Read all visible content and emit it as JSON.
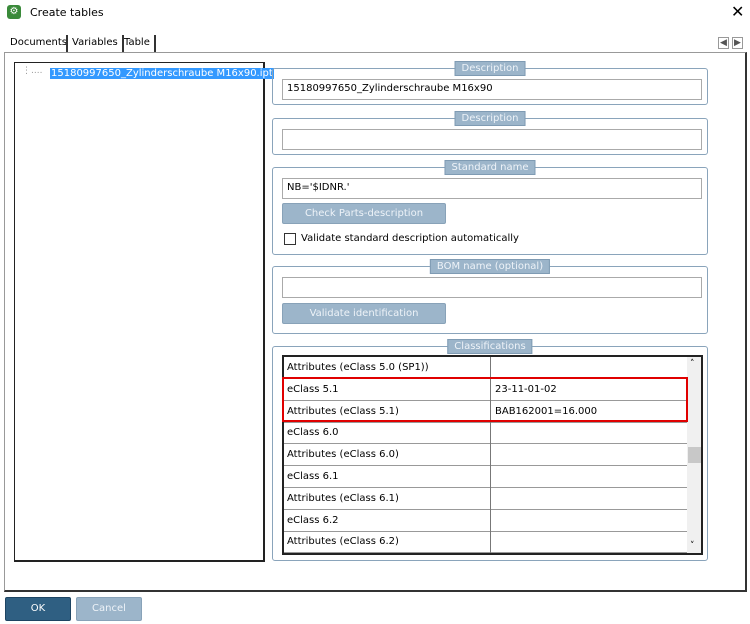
{
  "window": {
    "title": "Create tables",
    "icon": "app-gear-icon",
    "close": "✕"
  },
  "tabs": [
    {
      "label": "Documents"
    },
    {
      "label": "Variables"
    },
    {
      "label": "Table"
    }
  ],
  "nav": {
    "prev": "◀",
    "next": "▶"
  },
  "tree": {
    "item": "15180997650_Zylinderschraube M16x90.ipt",
    "connector": "⋮...."
  },
  "groups": {
    "desc1": {
      "legend": "Description",
      "value": "15180997650_Zylinderschraube M16x90"
    },
    "desc2": {
      "legend": "Description",
      "value": ""
    },
    "standard": {
      "legend": "Standard name",
      "value": "NB='$IDNR.'",
      "button": "Check Parts-description",
      "checkbox_label": "Validate standard description automatically",
      "checked": false
    },
    "bom": {
      "legend": "BOM name (optional)",
      "value": "",
      "button": "Validate identification"
    },
    "classifications": {
      "legend": "Classifications",
      "rows": [
        [
          "Attributes (eClass 5.0 (SP1))",
          ""
        ],
        [
          "eClass 5.1",
          "23-11-01-02"
        ],
        [
          "Attributes (eClass 5.1)",
          "BAB162001=16.000"
        ],
        [
          "eClass 6.0",
          ""
        ],
        [
          "Attributes (eClass 6.0)",
          ""
        ],
        [
          "eClass 6.1",
          ""
        ],
        [
          "Attributes (eClass 6.1)",
          ""
        ],
        [
          "eClass 6.2",
          ""
        ],
        [
          "Attributes (eClass 6.2)",
          ""
        ]
      ],
      "highlight_color": "#e00000"
    }
  },
  "footer": {
    "ok": "OK",
    "cancel": "Cancel"
  },
  "colors": {
    "accent": "#2f5f82",
    "disabled": "#9cb5ca",
    "selection": "#3399ff"
  }
}
